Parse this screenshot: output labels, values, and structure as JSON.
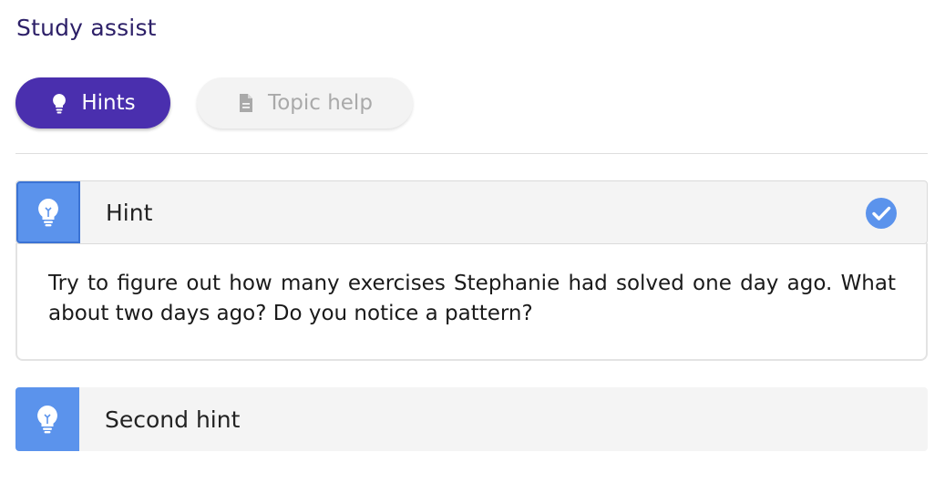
{
  "panel": {
    "title": "Study assist"
  },
  "tabs": [
    {
      "label": "Hints",
      "icon": "lightbulb-icon",
      "active": true
    },
    {
      "label": "Topic help",
      "icon": "document-icon",
      "active": false
    }
  ],
  "hints": [
    {
      "title": "Hint",
      "icon": "lightbulb-icon",
      "expanded": true,
      "completed": true,
      "body": "Try to figure out how many exercises Stephanie had solved one day ago. What about two days ago? Do you notice a pattern?"
    },
    {
      "title": "Second hint",
      "icon": "lightbulb-icon",
      "expanded": false,
      "completed": false
    }
  ],
  "colors": {
    "accent": "#4a2fae",
    "title": "#2d2068",
    "hint_icon_bg": "#5b93ec",
    "check": "#5b93ec"
  }
}
